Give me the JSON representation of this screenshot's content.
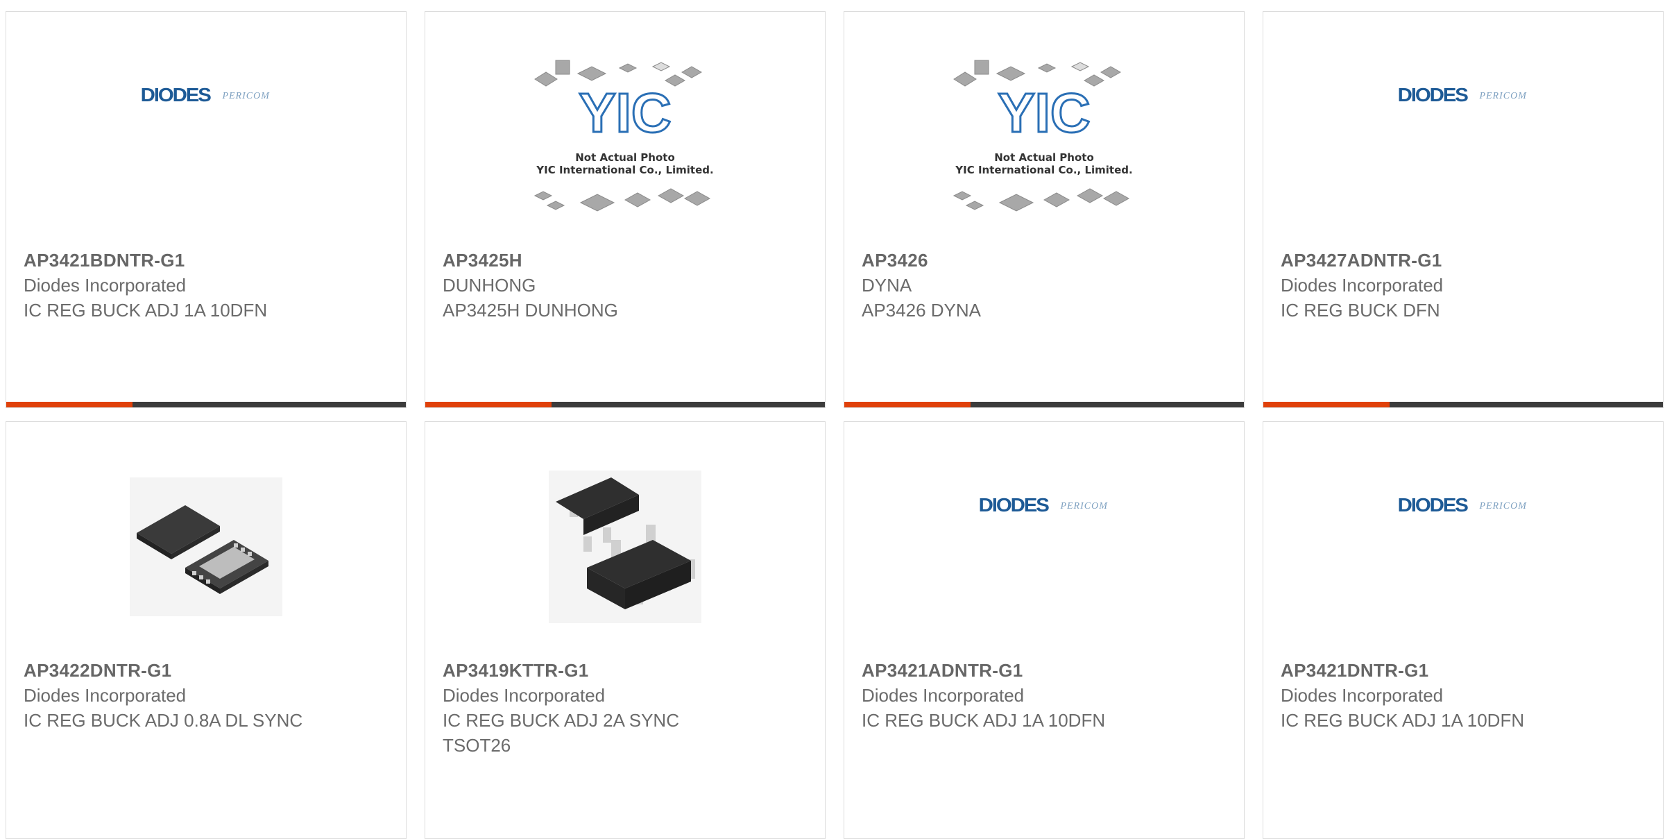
{
  "products": [
    {
      "part": "AP3421BDNTR-G1",
      "manufacturer": "Diodes Incorporated",
      "description": "IC REG BUCK ADJ 1A 10DFN",
      "image": "diodes-pericom-logo"
    },
    {
      "part": "AP3425H",
      "manufacturer": "DUNHONG",
      "description": "AP3425H DUNHONG",
      "image": "yic-placeholder"
    },
    {
      "part": "AP3426",
      "manufacturer": "DYNA",
      "description": "AP3426 DYNA",
      "image": "yic-placeholder"
    },
    {
      "part": "AP3427ADNTR-G1",
      "manufacturer": "Diodes Incorporated",
      "description": "IC REG BUCK DFN",
      "image": "diodes-pericom-logo"
    },
    {
      "part": "AP3422DNTR-G1",
      "manufacturer": "Diodes Incorporated",
      "description": "IC REG BUCK ADJ 0.8A DL SYNC",
      "image": "dfn-package-photo"
    },
    {
      "part": "AP3419KTTR-G1",
      "manufacturer": "Diodes Incorporated",
      "description": "IC REG BUCK ADJ 2A SYNC TSOT26",
      "image": "tsot26-package-photo"
    },
    {
      "part": "AP3421ADNTR-G1",
      "manufacturer": "Diodes Incorporated",
      "description": "IC REG BUCK ADJ 1A 10DFN",
      "image": "diodes-pericom-logo"
    },
    {
      "part": "AP3421DNTR-G1",
      "manufacturer": "Diodes Incorporated",
      "description": "IC REG BUCK ADJ 1A 10DFN",
      "image": "diodes-pericom-logo"
    }
  ],
  "logos": {
    "diodes": "DIODES",
    "pericom": "PERICOM",
    "yic": "YIC",
    "yic_note_1": "Not Actual Photo",
    "yic_note_2": "YIC International Co., Limited."
  },
  "colors": {
    "accent": "#e0410a",
    "bar": "#3c3c3c",
    "border": "#dcdcdc",
    "text": "#6b6b6b",
    "diodes_blue": "#1d5a96"
  }
}
